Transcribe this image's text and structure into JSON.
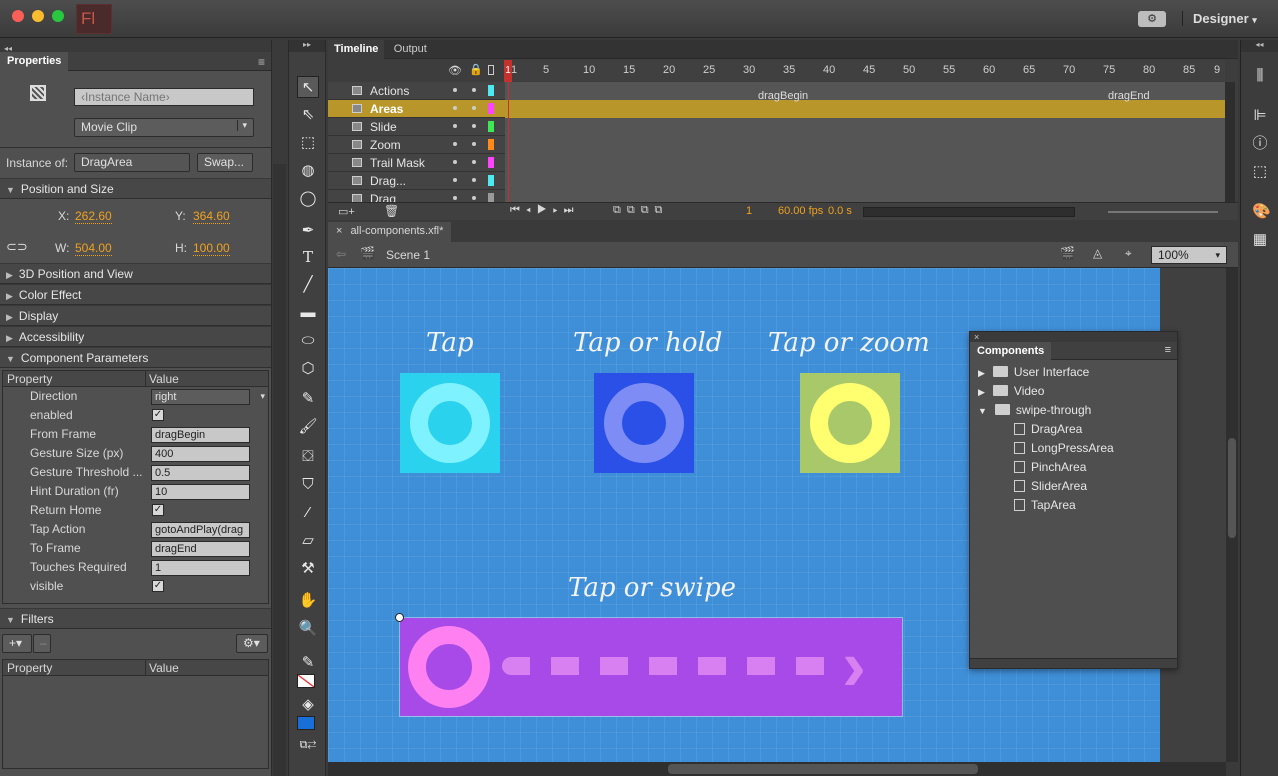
{
  "app": {
    "logo": "Fl",
    "workspace": "Designer",
    "workspace_icon": "gear-icon"
  },
  "properties": {
    "tab": "Properties",
    "instance_name_placeholder": "‹Instance Name›",
    "symbol_type": "Movie Clip",
    "instance_of_label": "Instance of:",
    "instance_of": "DragArea",
    "swap_label": "Swap...",
    "position_size": {
      "title": "Position and Size",
      "x_label": "X:",
      "x": "262.60",
      "y_label": "Y:",
      "y": "364.60",
      "w_label": "W:",
      "w": "504.00",
      "h_label": "H:",
      "h": "100.00"
    },
    "sections": [
      "3D Position and View",
      "Color Effect",
      "Display",
      "Accessibility"
    ],
    "component_parameters": {
      "title": "Component Parameters",
      "col_property": "Property",
      "col_value": "Value",
      "rows": [
        {
          "k": "Direction",
          "v": "right",
          "type": "select"
        },
        {
          "k": "enabled",
          "v": "✓",
          "type": "check"
        },
        {
          "k": "From Frame",
          "v": "dragBegin",
          "type": "text"
        },
        {
          "k": "Gesture Size (px)",
          "v": "400",
          "type": "text"
        },
        {
          "k": "Gesture Threshold ...",
          "v": "0.5",
          "type": "text"
        },
        {
          "k": "Hint Duration (fr)",
          "v": "10",
          "type": "text"
        },
        {
          "k": "Return Home",
          "v": "✓",
          "type": "check"
        },
        {
          "k": "Tap Action",
          "v": "gotoAndPlay(drag",
          "type": "text"
        },
        {
          "k": "To Frame",
          "v": "dragEnd",
          "type": "text"
        },
        {
          "k": "Touches Required",
          "v": "1",
          "type": "text"
        },
        {
          "k": "visible",
          "v": "✓",
          "type": "check"
        }
      ]
    },
    "filters": {
      "title": "Filters",
      "add": "+▾",
      "remove": "–",
      "col_property": "Property",
      "col_value": "Value"
    }
  },
  "timeline": {
    "tab": "Timeline",
    "tab2": "Output",
    "frame_numbers": [
      "1",
      "5",
      "10",
      "15",
      "20",
      "25",
      "30",
      "35",
      "40",
      "45",
      "50",
      "55",
      "60",
      "65",
      "70",
      "75",
      "80",
      "85",
      "9"
    ],
    "layers": [
      {
        "name": "Actions",
        "color": "#4de8f0",
        "highlight": false
      },
      {
        "name": "Areas",
        "color": "#ff44ff",
        "highlight": true
      },
      {
        "name": "Slide",
        "color": "#3ee854",
        "highlight": false
      },
      {
        "name": "Zoom",
        "color": "#ff8a1a",
        "highlight": false
      },
      {
        "name": "Trail Mask",
        "color": "#ff44ff",
        "highlight": false
      },
      {
        "name": "Drag...",
        "color": "#4de8f0",
        "highlight": false
      },
      {
        "name": "Drag",
        "color": "#9a9a9a",
        "highlight": false
      }
    ],
    "labels": {
      "begin": "dragBegin",
      "end": "dragEnd"
    },
    "status": {
      "frame": "1",
      "fps": "60.00 fps",
      "time": "0.0 s"
    }
  },
  "document": {
    "tab": "all-components.xfl*",
    "scene": "Scene 1",
    "zoom": "100%"
  },
  "stage": {
    "tap": "Tap",
    "tap_hold": "Tap or hold",
    "tap_zoom": "Tap or zoom",
    "tap_swipe": "Tap or swipe",
    "colors": {
      "tap_bg": "#2ad2ee",
      "tap_ring": "#7ff2ff",
      "hold_bg": "#2a50e8",
      "hold_ring": "#7d8df5",
      "zoom_bg": "#a8c86a",
      "zoom_ring": "#ffff70",
      "swipe_bg": "#a84ae8",
      "swipe_ring": "#ff80f0"
    }
  },
  "components": {
    "title": "Components",
    "items": [
      {
        "label": "User Interface",
        "kind": "folder",
        "level": 0,
        "expanded": false
      },
      {
        "label": "Video",
        "kind": "folder",
        "level": 0,
        "expanded": false
      },
      {
        "label": "swipe-through",
        "kind": "folder",
        "level": 0,
        "expanded": true
      },
      {
        "label": "DragArea",
        "kind": "symbol",
        "level": 1
      },
      {
        "label": "LongPressArea",
        "kind": "symbol",
        "level": 1
      },
      {
        "label": "PinchArea",
        "kind": "symbol",
        "level": 1
      },
      {
        "label": "SliderArea",
        "kind": "symbol",
        "level": 1
      },
      {
        "label": "TapArea",
        "kind": "symbol",
        "level": 1
      }
    ]
  }
}
